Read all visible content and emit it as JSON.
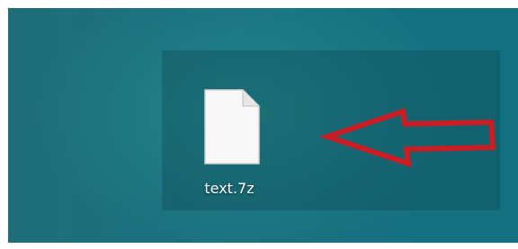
{
  "desktop": {
    "files": [
      {
        "label": "text.7z",
        "icon": "blank-file-icon"
      }
    ]
  },
  "annotation": {
    "arrow_color": "#c81e24",
    "arrow_direction": "left"
  }
}
